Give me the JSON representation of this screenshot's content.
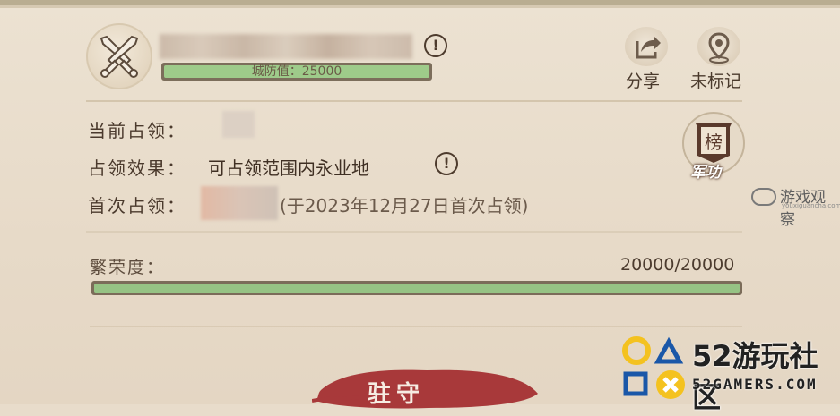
{
  "header": {
    "city_defense_label": "城防值：25000",
    "city_defense_fraction": 1.0
  },
  "actions": {
    "share_label": "分享",
    "mark_label": "未标记"
  },
  "info": {
    "current_occupant_label": "当前占领：",
    "occupy_effect_label": "占领效果：",
    "occupy_effect_value": "可占领范围内永业地",
    "first_occupy_label": "首次占领：",
    "first_occupy_value": "(于2023年12月27日首次占领)"
  },
  "rank": {
    "badge_char": "榜",
    "badge_label": "军功"
  },
  "prosperity": {
    "label": "繁荣度：",
    "value": "20000/20000",
    "fraction": 1.0
  },
  "footer": {
    "station_button_label": "驻守"
  },
  "watermarks": {
    "youxi_title": "游戏观察",
    "youxi_sub": "youxiguancha.com",
    "gamers_title": "52游玩社区",
    "gamers_sub": "52GAMERS.COM"
  },
  "colors": {
    "background": "#e8dccb",
    "bar_fill": "#96c384",
    "bar_track": "#7b6c59",
    "text": "#4b3a2d",
    "station_brush": "#a8393a"
  },
  "icons": [
    "crossed-swords-icon",
    "warning-icon",
    "share-icon",
    "map-pin-icon",
    "rank-medal-icon"
  ]
}
